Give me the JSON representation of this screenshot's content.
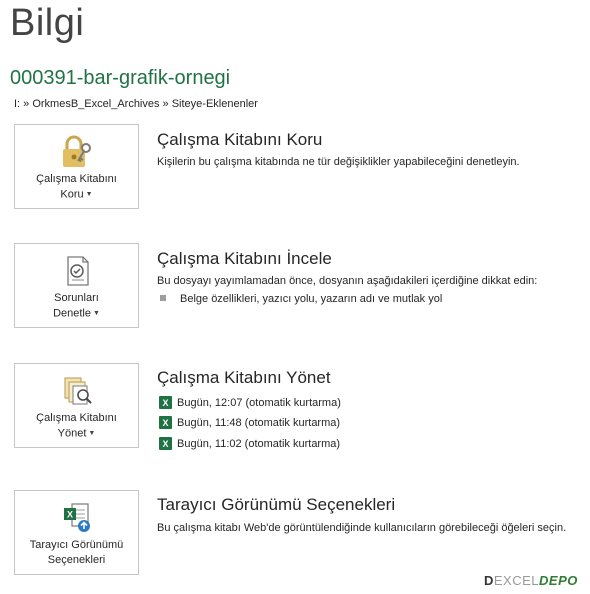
{
  "page": {
    "title": "Bilgi",
    "file_name": "000391-bar-grafik-ornegi",
    "breadcrumb": "I: » OrkmesB_Excel_Archives » Siteye-Eklenenler"
  },
  "sections": {
    "protect": {
      "tile_line1": "Çalışma Kitabını",
      "tile_line2": "Koru",
      "title": "Çalışma Kitabını Koru",
      "description": "Kişilerin bu çalışma kitabında ne tür değişiklikler yapabileceğini denetleyin."
    },
    "inspect": {
      "tile_line1": "Sorunları",
      "tile_line2": "Denetle",
      "title": "Çalışma Kitabını İncele",
      "description": "Bu dosyayı yayımlamadan önce, dosyanın aşağıdakileri içerdiğine dikkat edin:",
      "bullet": "Belge özellikleri, yazıcı yolu, yazarın adı ve mutlak yol"
    },
    "manage": {
      "tile_line1": "Çalışma Kitabını",
      "tile_line2": "Yönet",
      "title": "Çalışma Kitabını Yönet",
      "versions": [
        "Bugün, 12:07 (otomatik kurtarma)",
        "Bugün, 11:48 (otomatik kurtarma)",
        "Bugün, 11:02 (otomatik kurtarma)"
      ]
    },
    "browser": {
      "tile_line1": "Tarayıcı Görünümü",
      "tile_line2": "Seçenekleri",
      "title": "Tarayıcı Görünümü Seçenekleri",
      "description": "Bu çalışma kitabı Web'de görüntülendiğinde kullanıcıların görebileceği öğeleri seçin."
    }
  },
  "watermark": {
    "part1": "D",
    "part2": "EXCEL",
    "part3": "DEPO"
  },
  "colors": {
    "accent": "#217346",
    "tile_border": "#c6c6c6"
  },
  "icons": {
    "protect": "lock-key-icon",
    "inspect": "inspect-document-icon",
    "manage": "manage-versions-icon",
    "browser": "browser-view-icon",
    "version": "excel-file-icon"
  }
}
